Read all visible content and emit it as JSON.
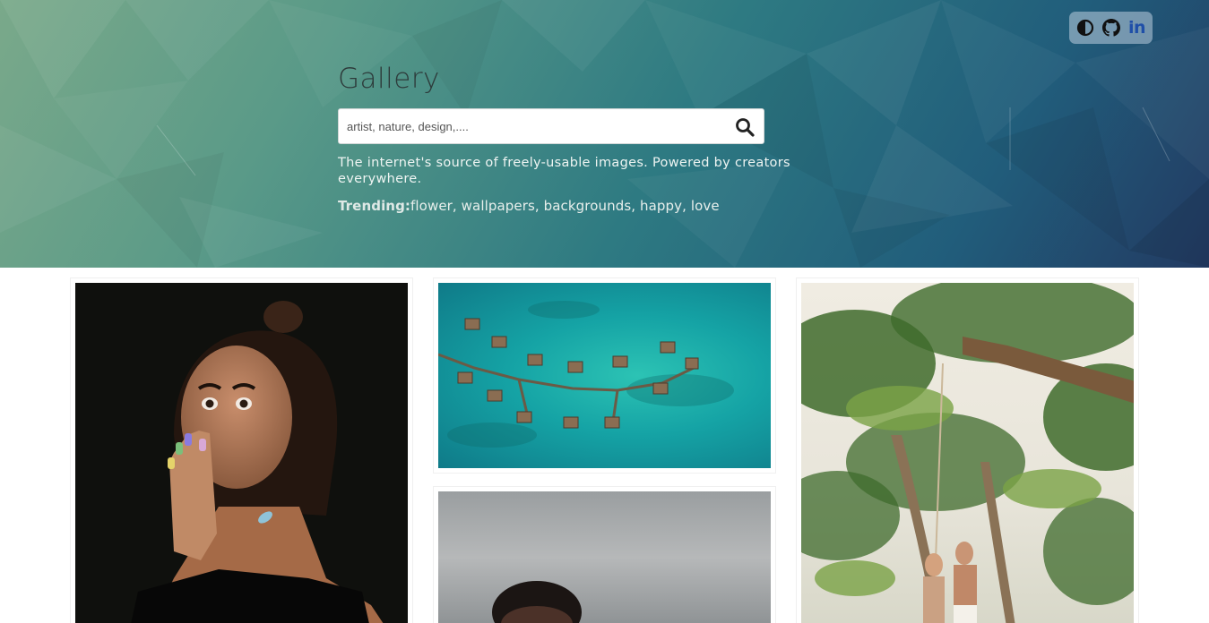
{
  "header": {
    "title": "Gallery",
    "search": {
      "placeholder": "artist, nature, design,....",
      "value": ""
    },
    "tagline": "The internet's source of freely-usable images. Powered by creators everywhere.",
    "trending_label": "Trending:",
    "trending_tags": "flower, wallpapers, backgrounds, happy, love"
  },
  "toolbar": {
    "theme_toggle_icon": "contrast-icon",
    "github_icon": "github-icon",
    "linkedin_label": "in"
  },
  "gallery": {
    "images": [
      {
        "subject": "woman-surprised-portrait",
        "description_icon": "photo"
      },
      {
        "subject": "overwater-bungalows-aerial",
        "description_icon": "photo"
      },
      {
        "subject": "palm-trees-swing",
        "description_icon": "photo"
      },
      {
        "subject": "man-portrait-grey",
        "description_icon": "photo"
      }
    ]
  },
  "colors": {
    "hero_start": "#7aa98a",
    "hero_end": "#223a62",
    "linkedin": "#1f4fa8",
    "title": "#2d3a3a"
  }
}
